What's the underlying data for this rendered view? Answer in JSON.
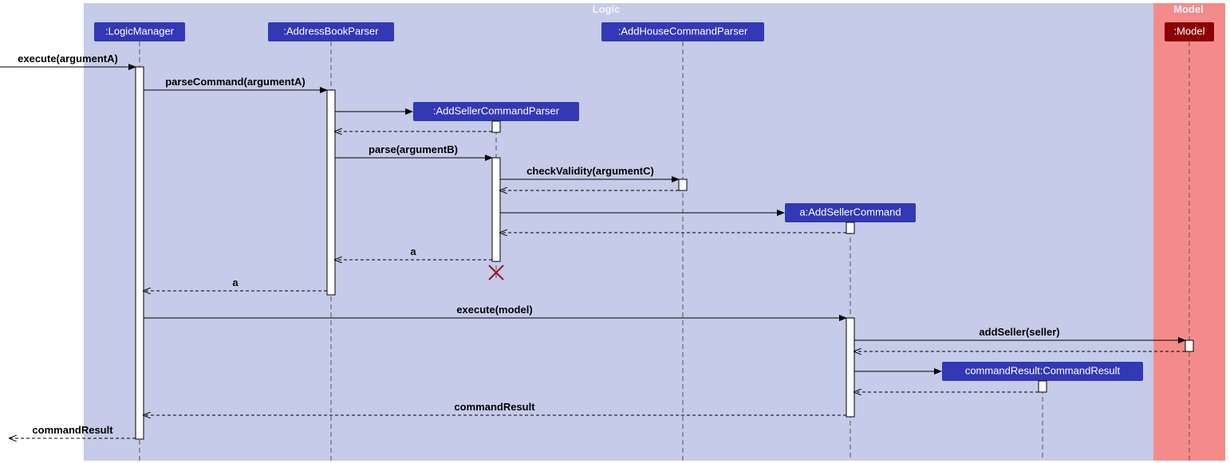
{
  "regions": {
    "logic": "Logic",
    "model": "Model"
  },
  "participants": {
    "logicManager": ":LogicManager",
    "addressBookParser": ":AddressBookParser",
    "addHouseCommandParser": ":AddHouseCommandParser",
    "addSellerCommandParser": ":AddSellerCommandParser",
    "addSellerCommand": "a:AddSellerCommand",
    "commandResult": "commandResult:CommandResult",
    "model": ":Model"
  },
  "messages": {
    "executeArgA": "execute(argumentA)",
    "parseCommand": "parseCommand(argumentA)",
    "parseB": "parse(argumentB)",
    "checkValidity": "checkValidity(argumentC)",
    "a1": "a",
    "a2": "a",
    "executeModel": "execute(model)",
    "addSeller": "addSeller(seller)",
    "commandResultLabel": "commandResult",
    "commandResultReturn": "commandResult"
  }
}
